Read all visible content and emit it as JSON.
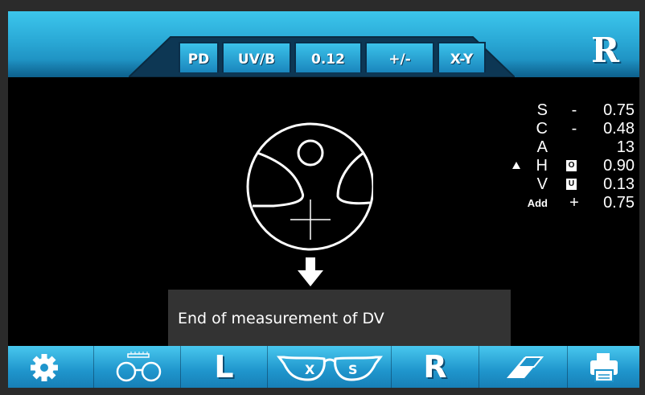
{
  "tabs": [
    {
      "label": "PD"
    },
    {
      "label": "UV/B"
    },
    {
      "label": "0.12"
    },
    {
      "label": "+/-"
    },
    {
      "label": "X-Y"
    }
  ],
  "side_indicator": "R",
  "readings": {
    "s": {
      "label": "S",
      "sign": "-",
      "value": "0.75"
    },
    "c": {
      "label": "C",
      "sign": "-",
      "value": "0.48"
    },
    "a": {
      "label": "A",
      "value": "13"
    },
    "h": {
      "label": "H",
      "box": "O",
      "value": "0.90"
    },
    "v": {
      "label": "V",
      "box": "U",
      "value": "0.13"
    },
    "add": {
      "label": "Add",
      "sign": "+",
      "value": "0.75"
    }
  },
  "message": "End of measurement of DV",
  "bottom_bar": {
    "left_label": "L",
    "right_label": "R",
    "lens_letter_left": "X",
    "lens_letter_right": "S",
    "icons": [
      "gear-icon",
      "pd-ruler-glasses-icon",
      "left-lens-button",
      "glasses-single-progressive-icon",
      "right-lens-button",
      "eraser-icon",
      "printer-icon"
    ]
  },
  "colors": {
    "accent": "#2aa9d6",
    "screen_bg": "#000000",
    "message_bg": "#333333"
  }
}
